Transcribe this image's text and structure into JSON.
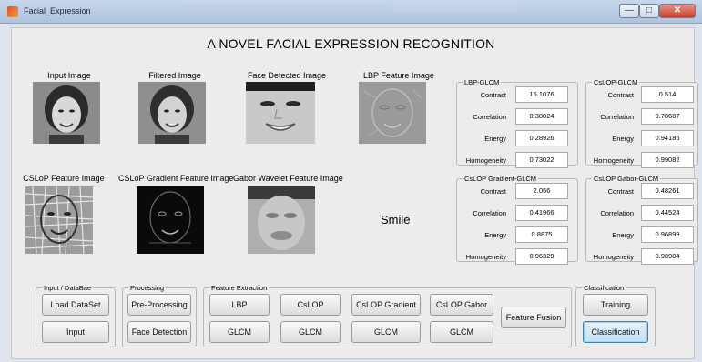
{
  "window": {
    "title": "Facial_Expression",
    "min": "—",
    "max": "□",
    "close": "✕"
  },
  "app_title": "A NOVEL FACIAL EXPRESSION RECOGNITION",
  "images": {
    "input": "Input Image",
    "filtered": "Filtered Image",
    "face_detected": "Face Detected Image",
    "lbp": "LBP Feature Image",
    "cslop": "CSLoP Feature Image",
    "cslop_gradient": "CSLoP Gradient Feature Image",
    "gabor": "Gabor Wavelet Feature Image"
  },
  "result": "Smile",
  "labels": {
    "contrast": "Contrast",
    "correlation": "Correlation",
    "energy": "Energy",
    "homogeneity": "Homogeneity"
  },
  "glcm": {
    "lbp": {
      "title": "LBP-GLCM",
      "contrast": "15.1076",
      "correlation": "0.38024",
      "energy": "0.28926",
      "homogeneity": "0.73022"
    },
    "cslop": {
      "title": "CsLOP-GLCM",
      "contrast": "0.514",
      "correlation": "0.78687",
      "energy": "0.94186",
      "homogeneity": "0.99082"
    },
    "gradient": {
      "title": "CsLOP Gradient-GLCM",
      "contrast": "2.056",
      "correlation": "0.41966",
      "energy": "0.8875",
      "homogeneity": "0.96329"
    },
    "gabor": {
      "title": "CsLOP Gabor-GLCM",
      "contrast": "0.48261",
      "correlation": "0.44524",
      "energy": "0.96899",
      "homogeneity": "0.98984"
    }
  },
  "groups": {
    "input": {
      "title": "Input / DataBae",
      "load": "Load DataSet",
      "input": "Input"
    },
    "processing": {
      "title": "Processing",
      "pre": "Pre-Processing",
      "face": "Face Detection"
    },
    "feature": {
      "title": "Feature Extraction",
      "lbp": "LBP",
      "cslop": "CsLOP",
      "gradient": "CsLOP Gradient",
      "gabor": "CsLOP Gabor",
      "glcm": "GLCM",
      "fusion": "Feature Fusion"
    },
    "classification": {
      "title": "Classification",
      "training": "Training",
      "classify": "Classification"
    }
  },
  "colors": {
    "titlebar": "#b8cbe2",
    "panel": "#ececec",
    "focus": "#c4dff5"
  }
}
